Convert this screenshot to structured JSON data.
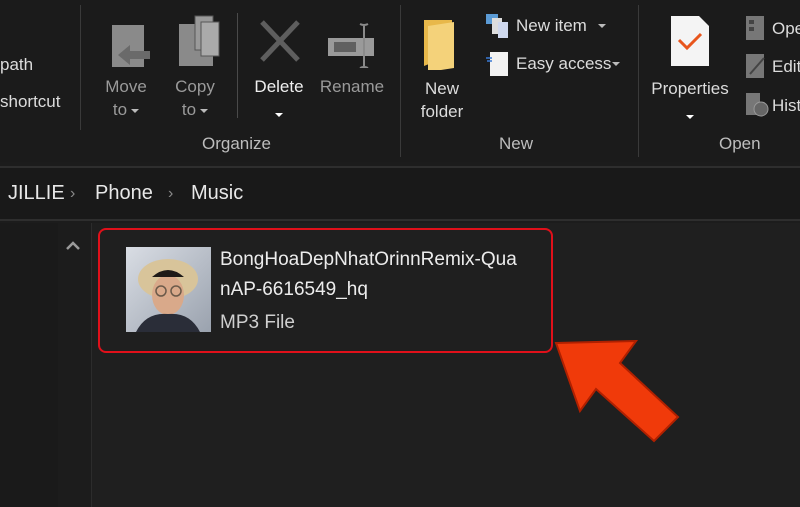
{
  "ribbon": {
    "clipboard_partial": {
      "copy_path": "path",
      "paste_shortcut": "shortcut"
    },
    "organize": {
      "group_label": "Organize",
      "move_to": [
        "Move",
        "to"
      ],
      "copy_to": [
        "Copy",
        "to"
      ],
      "delete": "Delete",
      "rename": "Rename"
    },
    "new": {
      "group_label": "New",
      "new_folder": [
        "New",
        "folder"
      ],
      "new_item": "New item",
      "easy_access": "Easy access"
    },
    "open": {
      "group_label": "Open",
      "properties": "Properties",
      "open_partial": "Ope",
      "edit_partial": "Edit",
      "history_partial": "Hist"
    }
  },
  "breadcrumb": [
    "JILLIE",
    "Phone",
    "Music"
  ],
  "file": {
    "name_line1": "BongHoaDepNhatOrinnRemix-Qua",
    "name_line2": "nAP-6616549_hq",
    "type": "MP3 File"
  },
  "colors": {
    "highlight": "#e0101a",
    "arrow": "#f03a0a",
    "check": "#e8551c",
    "folder": "#f0c75a"
  }
}
